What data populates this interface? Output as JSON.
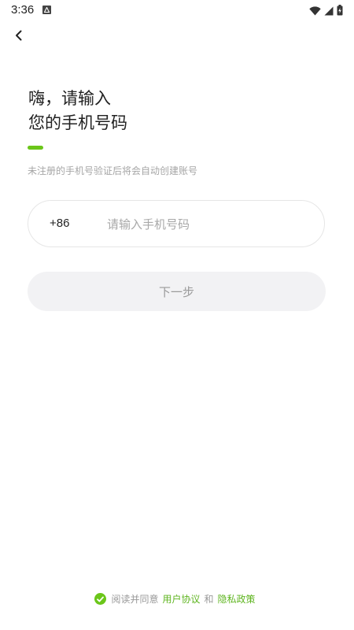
{
  "status_bar": {
    "time": "3:36"
  },
  "header": {
    "title_line1": "嗨，请输入",
    "title_line2": "您的手机号码",
    "subtitle": "未注册的手机号验证后将会自动创建账号"
  },
  "phone": {
    "country_code": "+86",
    "placeholder": "请输入手机号码",
    "value": ""
  },
  "next_button": {
    "label": "下一步"
  },
  "agreement": {
    "prefix": "阅读并同意",
    "user_agreement": "用户协议",
    "conjunction": "和",
    "privacy_policy": "隐私政策",
    "checked": true
  },
  "colors": {
    "accent": "#6bc61a",
    "link": "#5fb520",
    "disabled_button_bg": "#f2f2f4"
  },
  "icons": {
    "back": "chevron-left-icon",
    "check": "check-circle-icon",
    "wifi": "wifi-icon",
    "signal": "signal-icon",
    "battery": "battery-charging-icon"
  }
}
